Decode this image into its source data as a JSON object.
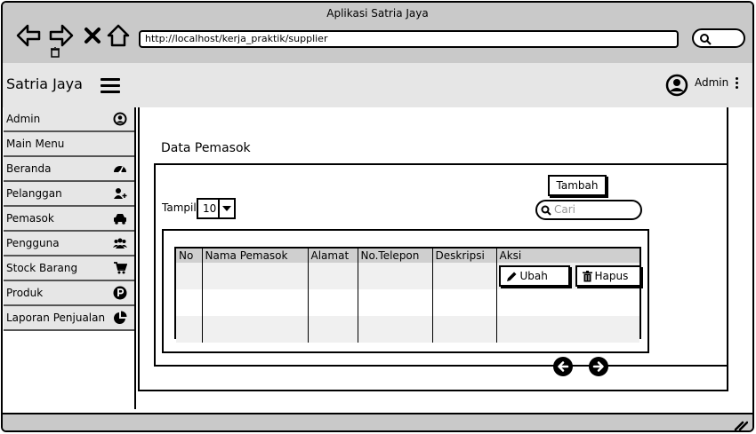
{
  "window": {
    "title": "Aplikasi Satria Jaya",
    "url": "http://localhost/kerja_praktik/supplier"
  },
  "header": {
    "brand": "Satria Jaya",
    "user": "Admin"
  },
  "sidebar": {
    "items": [
      {
        "label": "Admin",
        "icon": "user-circle-icon"
      },
      {
        "label": "Main Menu",
        "icon": ""
      },
      {
        "label": "Beranda",
        "icon": "dashboard-icon"
      },
      {
        "label": "Pelanggan",
        "icon": "add-user-icon"
      },
      {
        "label": "Pemasok",
        "icon": "car-icon"
      },
      {
        "label": "Pengguna",
        "icon": "users-icon"
      },
      {
        "label": "Stock Barang",
        "icon": "cart-icon"
      },
      {
        "label": "Produk",
        "icon": "product-p-icon"
      },
      {
        "label": "Laporan Penjualan",
        "icon": "pie-chart-icon"
      }
    ]
  },
  "main": {
    "title": "Data Pemasok",
    "add_label": "Tambah",
    "show_label": "Tampil",
    "show_value": "10",
    "search_placeholder": "Cari",
    "table": {
      "columns": [
        "No",
        "Nama Pemasok",
        "Alamat",
        "No.Telepon",
        "Deskripsi",
        "Aksi"
      ],
      "edit_label": "Ubah",
      "delete_label": "Hapus"
    }
  }
}
